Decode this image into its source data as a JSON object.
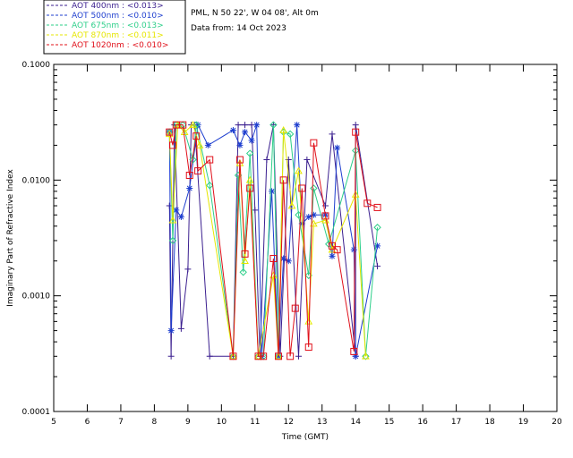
{
  "header": {
    "station": "PML, N 50 22', W 04 08', Alt 0m",
    "date": "Data from: 14 Oct 2023"
  },
  "chart_data": {
    "type": "line",
    "xlabel": "Time (GMT)",
    "ylabel": "Imaginary Part of Refractive Index",
    "xlim": [
      5,
      20
    ],
    "ylim": [
      0.0001,
      0.1
    ],
    "yscale": "log",
    "xticks": [
      "5",
      "6",
      "7",
      "8",
      "9",
      "10",
      "11",
      "12",
      "13",
      "14",
      "15",
      "16",
      "17",
      "18",
      "19",
      "20"
    ],
    "yticks": [
      "0.0001",
      "0.0010",
      "0.0100",
      "0.1000"
    ],
    "legend_position": "top-left",
    "series": [
      {
        "name": "AOT  400nm : <0.013>",
        "color": "#3b1f8f",
        "marker": "plus",
        "points": [
          [
            8.45,
            0.006
          ],
          [
            8.5,
            0.0003
          ],
          [
            8.6,
            0.03
          ],
          [
            8.8,
            0.00052
          ],
          [
            9.0,
            0.0017
          ],
          [
            9.1,
            0.03
          ],
          [
            9.2,
            0.03
          ],
          [
            9.65,
            0.0003
          ],
          [
            10.35,
            0.0003
          ],
          [
            10.5,
            0.03
          ],
          [
            10.7,
            0.03
          ],
          [
            10.9,
            0.03
          ],
          [
            11.0,
            0.0055
          ],
          [
            11.15,
            0.0003
          ],
          [
            11.35,
            0.015
          ],
          [
            11.55,
            0.03
          ],
          [
            11.75,
            0.0003
          ],
          [
            12.0,
            0.015
          ],
          [
            12.3,
            0.0003
          ],
          [
            12.55,
            0.015
          ],
          [
            13.1,
            0.006
          ],
          [
            13.3,
            0.025
          ],
          [
            14.0,
            0.0003
          ],
          [
            14.0,
            0.03
          ],
          [
            14.65,
            0.0018
          ]
        ]
      },
      {
        "name": "AOT  500nm : <0.010>",
        "color": "#1f3fcf",
        "marker": "star",
        "points": [
          [
            8.45,
            0.026
          ],
          [
            8.5,
            0.0005
          ],
          [
            8.65,
            0.0055
          ],
          [
            8.8,
            0.0048
          ],
          [
            9.05,
            0.0085
          ],
          [
            9.3,
            0.03
          ],
          [
            9.6,
            0.02
          ],
          [
            10.35,
            0.027
          ],
          [
            10.55,
            0.02
          ],
          [
            10.7,
            0.026
          ],
          [
            10.9,
            0.022
          ],
          [
            11.05,
            0.03
          ],
          [
            11.2,
            0.0003
          ],
          [
            11.5,
            0.008
          ],
          [
            11.7,
            0.0003
          ],
          [
            11.85,
            0.0021
          ],
          [
            12.0,
            0.002
          ],
          [
            12.25,
            0.03
          ],
          [
            12.4,
            0.0042
          ],
          [
            12.6,
            0.0048
          ],
          [
            12.75,
            0.005
          ],
          [
            13.1,
            0.005
          ],
          [
            13.3,
            0.0022
          ],
          [
            13.45,
            0.019
          ],
          [
            13.95,
            0.0025
          ],
          [
            14.0,
            0.0003
          ],
          [
            14.65,
            0.0027
          ]
        ]
      },
      {
        "name": "AOT  675nm : <0.013>",
        "color": "#2ecf8a",
        "marker": "diamond",
        "points": [
          [
            8.45,
            0.026
          ],
          [
            8.55,
            0.003
          ],
          [
            8.65,
            0.03
          ],
          [
            8.85,
            0.03
          ],
          [
            9.15,
            0.015
          ],
          [
            9.25,
            0.03
          ],
          [
            9.65,
            0.009
          ],
          [
            10.35,
            0.0003
          ],
          [
            10.5,
            0.011
          ],
          [
            10.65,
            0.0016
          ],
          [
            10.85,
            0.017
          ],
          [
            11.1,
            0.0003
          ],
          [
            11.25,
            0.0003
          ],
          [
            11.55,
            0.03
          ],
          [
            11.7,
            0.0003
          ],
          [
            11.85,
            0.026
          ],
          [
            12.05,
            0.025
          ],
          [
            12.3,
            0.005
          ],
          [
            12.6,
            0.0015
          ],
          [
            12.75,
            0.0085
          ],
          [
            13.2,
            0.0028
          ],
          [
            14.0,
            0.018
          ],
          [
            14.3,
            0.0003
          ],
          [
            14.65,
            0.0039
          ]
        ]
      },
      {
        "name": "AOT  870nm : <0.011>",
        "color": "#e6e600",
        "marker": "triangle",
        "points": [
          [
            8.45,
            0.025
          ],
          [
            8.55,
            0.0045
          ],
          [
            8.7,
            0.03
          ],
          [
            8.9,
            0.026
          ],
          [
            9.15,
            0.03
          ],
          [
            9.35,
            0.02
          ],
          [
            10.35,
            0.0003
          ],
          [
            10.55,
            0.014
          ],
          [
            10.7,
            0.002
          ],
          [
            10.85,
            0.01
          ],
          [
            11.1,
            0.0003
          ],
          [
            11.55,
            0.0015
          ],
          [
            11.7,
            0.0003
          ],
          [
            11.85,
            0.027
          ],
          [
            12.1,
            0.006
          ],
          [
            12.3,
            0.012
          ],
          [
            12.6,
            0.0006
          ],
          [
            12.75,
            0.0042
          ],
          [
            13.1,
            0.0045
          ],
          [
            13.3,
            0.0025
          ],
          [
            14.0,
            0.0075
          ],
          [
            14.3,
            0.0003
          ]
        ]
      },
      {
        "name": "AOT 1020nm : <0.010>",
        "color": "#e0101a",
        "marker": "square",
        "points": [
          [
            8.45,
            0.026
          ],
          [
            8.55,
            0.02
          ],
          [
            8.65,
            0.03
          ],
          [
            8.85,
            0.03
          ],
          [
            9.05,
            0.011
          ],
          [
            9.25,
            0.024
          ],
          [
            9.3,
            0.012
          ],
          [
            9.65,
            0.015
          ],
          [
            10.35,
            0.0003
          ],
          [
            10.55,
            0.015
          ],
          [
            10.7,
            0.0023
          ],
          [
            10.85,
            0.0085
          ],
          [
            11.1,
            0.0003
          ],
          [
            11.25,
            0.0003
          ],
          [
            11.55,
            0.0021
          ],
          [
            11.7,
            0.0003
          ],
          [
            11.85,
            0.01
          ],
          [
            12.05,
            0.0003
          ],
          [
            12.2,
            0.00078
          ],
          [
            12.4,
            0.0085
          ],
          [
            12.6,
            0.00036
          ],
          [
            12.75,
            0.021
          ],
          [
            13.1,
            0.0049
          ],
          [
            13.3,
            0.0027
          ],
          [
            13.45,
            0.0025
          ],
          [
            13.95,
            0.00033
          ],
          [
            14.0,
            0.026
          ],
          [
            14.35,
            0.0063
          ],
          [
            14.65,
            0.0058
          ]
        ]
      }
    ]
  }
}
